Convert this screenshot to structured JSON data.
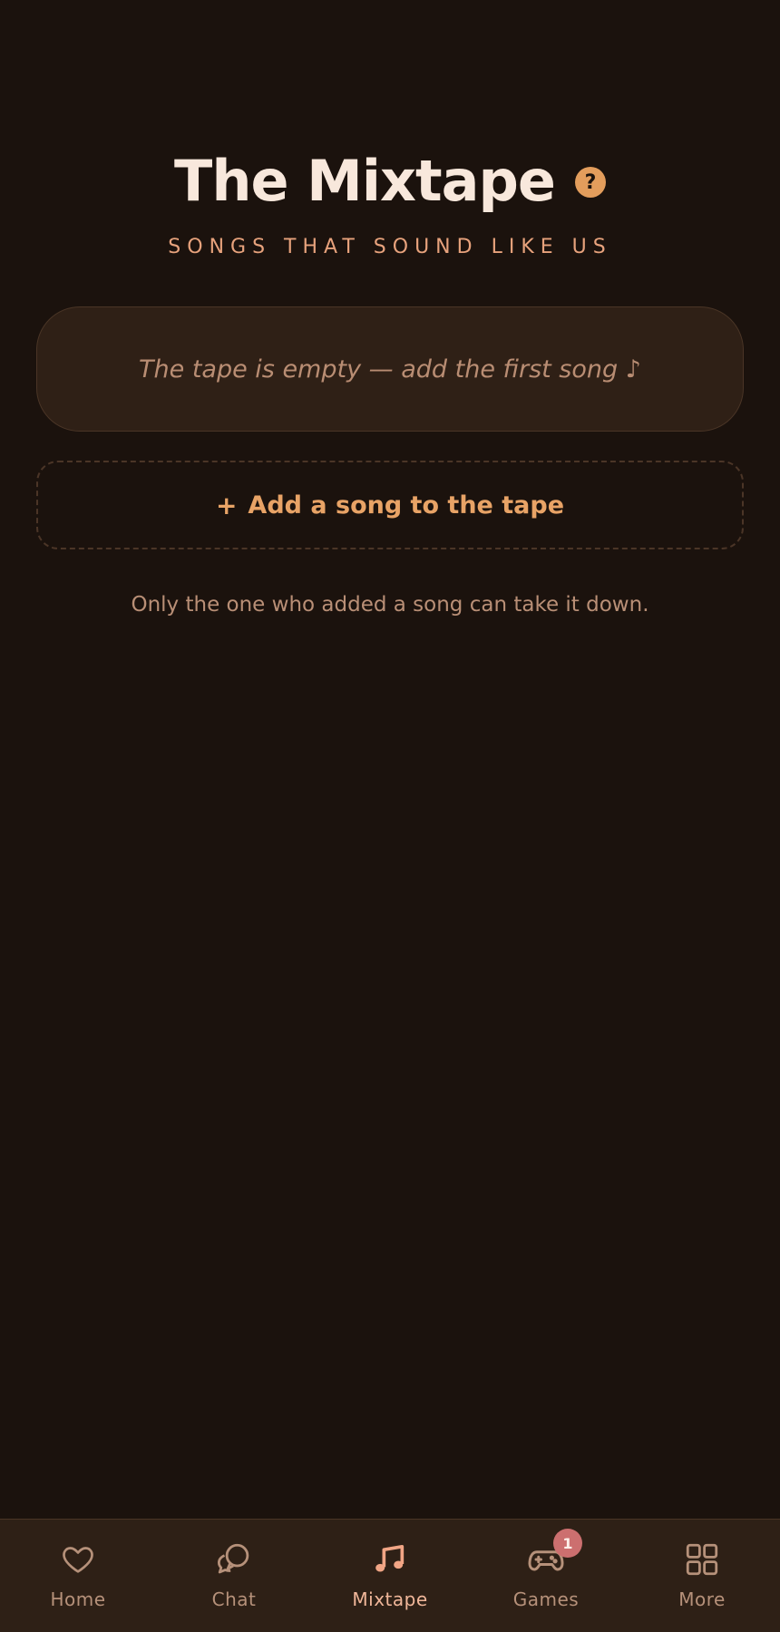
{
  "header": {
    "title": "The Mixtape",
    "help_symbol": "?",
    "subtitle": "SONGS THAT SOUND LIKE US"
  },
  "tape": {
    "empty_message": "The tape is empty — add the first song ♪"
  },
  "add_button": {
    "plus": "+",
    "label": "Add a song to the tape"
  },
  "note": "Only the one who added a song can take it down.",
  "nav": {
    "items": [
      {
        "label": "Home",
        "icon": "heart-icon"
      },
      {
        "label": "Chat",
        "icon": "chat-bubbles-icon"
      },
      {
        "label": "Mixtape",
        "icon": "music-note-icon",
        "active": true
      },
      {
        "label": "Games",
        "icon": "gamepad-icon",
        "badge": "1"
      },
      {
        "label": "More",
        "icon": "grid-icon"
      }
    ]
  },
  "colors": {
    "background": "#1b120d",
    "surface": "#2f2016",
    "accent": "#e39d5c",
    "active_nav": "#f1b79a",
    "badge": "#cc6f6f"
  }
}
